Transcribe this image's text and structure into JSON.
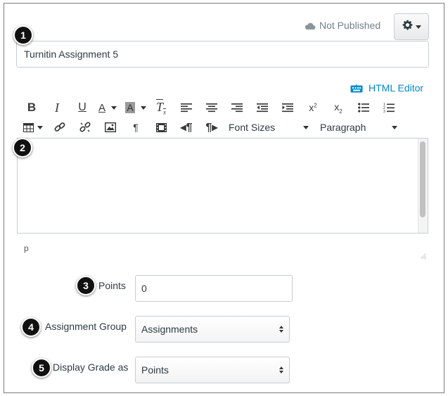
{
  "header": {
    "publish_status": "Not Published",
    "settings_icon": "gear-icon",
    "settings_caret": "caret-down-icon"
  },
  "title_field": {
    "value": "Turnitin Assignment 5"
  },
  "editor": {
    "html_editor_label": "HTML Editor",
    "font_sizes_label": "Font Sizes",
    "paragraph_label": "Paragraph",
    "toolbar_row1": [
      "bold",
      "italic",
      "underline",
      "text-color",
      "background-color",
      "clear-formatting",
      "align-left",
      "align-center",
      "align-right",
      "outdent",
      "indent",
      "superscript",
      "subscript",
      "bulleted-list",
      "numbered-list"
    ],
    "toolbar_row2": [
      "table",
      "link",
      "unlink",
      "image",
      "paragraph-mark",
      "media",
      "ltr",
      "rtl"
    ],
    "path": "p"
  },
  "fields": {
    "points_label": "Points",
    "points_value": "0",
    "group_label": "Assignment Group",
    "group_value": "Assignments",
    "display_label": "Display Grade as",
    "display_value": "Points"
  },
  "badges": [
    "1",
    "2",
    "3",
    "4",
    "5"
  ],
  "colors": {
    "link": "#0088cc",
    "badge": "#111111",
    "border": "#c7cdd1",
    "muted": "#73818c"
  }
}
